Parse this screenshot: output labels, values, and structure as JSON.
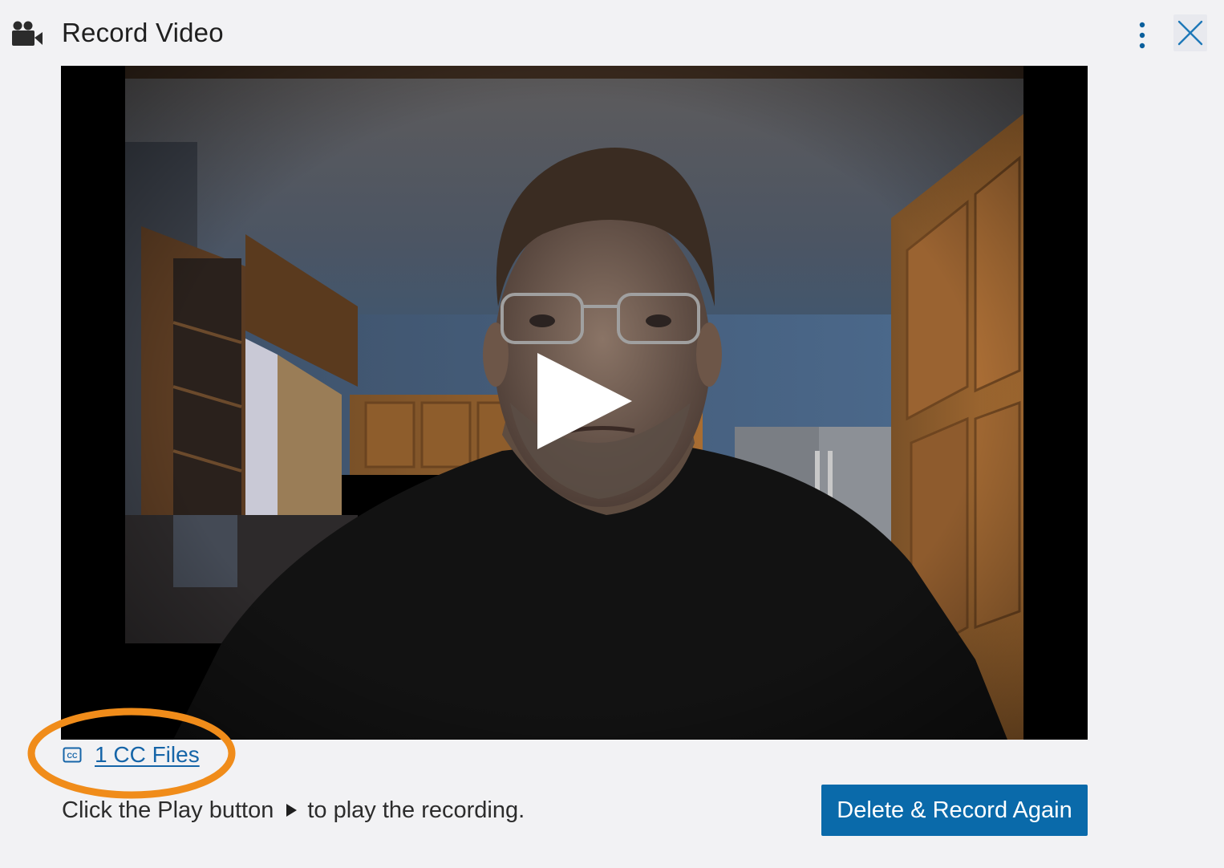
{
  "header": {
    "icon": "video-camera-icon",
    "title": "Record Video",
    "menu_icon": "more-vertical-icon",
    "close_icon": "close-icon"
  },
  "video": {
    "play_icon": "play-icon"
  },
  "captions": {
    "icon": "closed-captions-icon",
    "link_label": "1 CC Files"
  },
  "instruction": {
    "before": "Click the Play button",
    "inline_icon": "play-triangle-icon",
    "after": "to play the recording."
  },
  "actions": {
    "delete_record_label": "Delete & Record Again"
  },
  "colors": {
    "background": "#f2f2f4",
    "accent": "#0a6aaa",
    "link": "#1665a8",
    "highlight": "#f08c1a"
  }
}
